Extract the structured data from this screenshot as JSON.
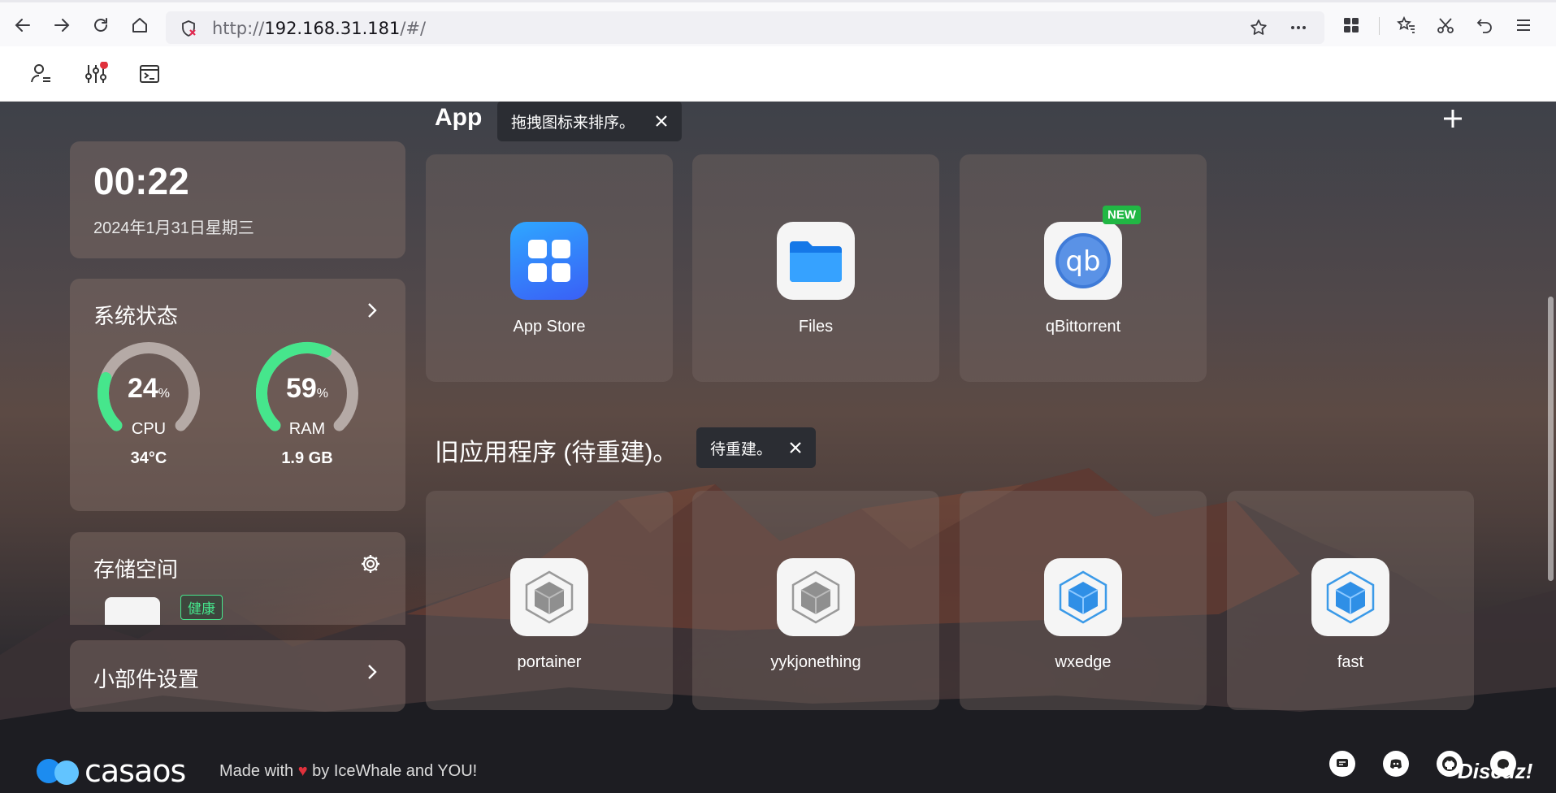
{
  "browser": {
    "url_prefix": "http://",
    "url_host": "192.168.31.181",
    "url_path": "/#/"
  },
  "topbar": {
    "icons": [
      "user-settings-icon",
      "sliders-icon",
      "terminal-icon"
    ]
  },
  "clock": {
    "time": "00:22",
    "date": "2024年1月31日星期三"
  },
  "system_status": {
    "title": "系统状态",
    "cpu": {
      "value": "24",
      "unit": "%",
      "label": "CPU",
      "sub": "34°C",
      "fraction": 0.24
    },
    "ram": {
      "value": "59",
      "unit": "%",
      "label": "RAM",
      "sub": "1.9 GB",
      "fraction": 0.59
    }
  },
  "storage": {
    "title": "存储空间",
    "health_badge": "健康"
  },
  "widget_settings": {
    "title": "小部件设置"
  },
  "apps_section": {
    "title": "App",
    "tooltip": "拖拽图标来排序。",
    "apps": [
      {
        "name": "App Store",
        "icon": "app-store-icon"
      },
      {
        "name": "Files",
        "icon": "folder-icon"
      },
      {
        "name": "qBittorrent",
        "icon": "qbittorrent-icon",
        "badge": "NEW"
      }
    ]
  },
  "legacy_section": {
    "title": "旧应用程序 (待重建)。",
    "tooltip": "待重建。",
    "apps": [
      {
        "name": "portainer",
        "icon": "gray-cube-icon"
      },
      {
        "name": "yykjonething",
        "icon": "gray-cube-icon"
      },
      {
        "name": "wxedge",
        "icon": "blue-cube-icon"
      },
      {
        "name": "fast",
        "icon": "blue-cube-icon"
      }
    ]
  },
  "footer": {
    "logo_text": "casaos",
    "made_with": "Made with",
    "by_text": "by IceWhale and YOU!",
    "watermark": "Discuz!"
  },
  "colors": {
    "accent_green": "#21b744",
    "gauge_green": "#46e68c",
    "gauge_track": "#b5aaa6",
    "heart": "#e0313c"
  }
}
